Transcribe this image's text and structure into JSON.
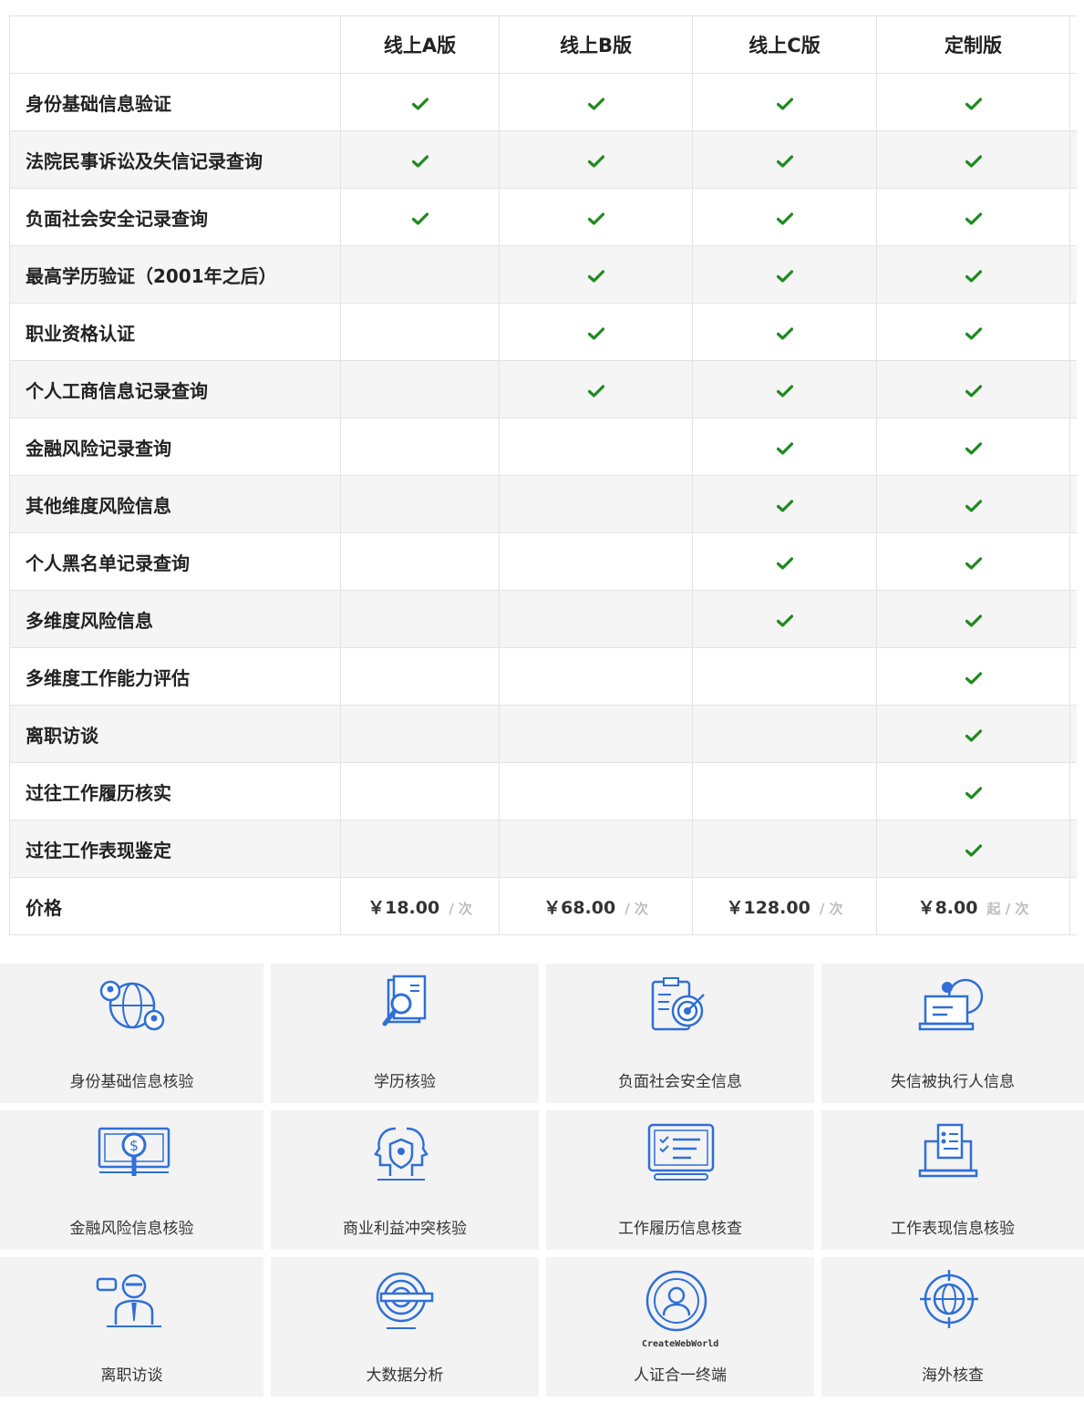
{
  "table": {
    "headers": [
      "",
      "线上A版",
      "线上B版",
      "线上C版",
      "定制版"
    ],
    "rows": [
      {
        "label": "身份基础信息验证",
        "checks": [
          true,
          true,
          true,
          true
        ]
      },
      {
        "label": "法院民事诉讼及失信记录查询",
        "checks": [
          true,
          true,
          true,
          true
        ]
      },
      {
        "label": "负面社会安全记录查询",
        "checks": [
          true,
          true,
          true,
          true
        ]
      },
      {
        "label": "最高学历验证（2001年之后）",
        "checks": [
          false,
          true,
          true,
          true
        ]
      },
      {
        "label": "职业资格认证",
        "checks": [
          false,
          true,
          true,
          true
        ]
      },
      {
        "label": "个人工商信息记录查询",
        "checks": [
          false,
          true,
          true,
          true
        ]
      },
      {
        "label": "金融风险记录查询",
        "checks": [
          false,
          false,
          true,
          true
        ]
      },
      {
        "label": "其他维度风险信息",
        "checks": [
          false,
          false,
          true,
          true
        ]
      },
      {
        "label": "个人黑名单记录查询",
        "checks": [
          false,
          false,
          true,
          true
        ]
      },
      {
        "label": "多维度风险信息",
        "checks": [
          false,
          false,
          true,
          true
        ]
      },
      {
        "label": "多维度工作能力评估",
        "checks": [
          false,
          false,
          false,
          true
        ]
      },
      {
        "label": "离职访谈",
        "checks": [
          false,
          false,
          false,
          true
        ]
      },
      {
        "label": "过往工作履历核实",
        "checks": [
          false,
          false,
          false,
          true
        ]
      },
      {
        "label": "过往工作表现鉴定",
        "checks": [
          false,
          false,
          false,
          true
        ]
      }
    ],
    "price_row": {
      "label": "价格",
      "prices": [
        {
          "amount": "￥18.00",
          "unit": "/ 次"
        },
        {
          "amount": "￥68.00",
          "unit": "/ 次"
        },
        {
          "amount": "￥128.00",
          "unit": "/ 次"
        },
        {
          "amount": "￥8.00",
          "unit": "起 / 次"
        }
      ]
    }
  },
  "services": [
    {
      "label": "身份基础信息核验",
      "icon": "globe-people-icon"
    },
    {
      "label": "学历核验",
      "icon": "document-search-icon"
    },
    {
      "label": "负面社会安全信息",
      "icon": "clipboard-target-icon"
    },
    {
      "label": "失信被执行人信息",
      "icon": "laptop-globe-icon"
    },
    {
      "label": "金融风险信息核验",
      "icon": "money-magnifier-icon"
    },
    {
      "label": "商业利益冲突核验",
      "icon": "heads-shield-icon"
    },
    {
      "label": "工作履历信息核查",
      "icon": "tablet-checklist-icon"
    },
    {
      "label": "工作表现信息核验",
      "icon": "laptop-document-icon"
    },
    {
      "label": "离职访谈",
      "icon": "interview-person-icon"
    },
    {
      "label": "大数据分析",
      "icon": "radar-pencil-icon"
    },
    {
      "label": "人证合一终端",
      "icon": "person-circle-icon"
    },
    {
      "label": "海外核查",
      "icon": "globe-crosshair-icon"
    }
  ],
  "watermark": "CreateWebWorld",
  "colors": {
    "check": "#1f8a1f",
    "icon": "#2f6fd6",
    "tile_bg": "#f3f3f3",
    "alt_row": "#f5f5f5"
  }
}
